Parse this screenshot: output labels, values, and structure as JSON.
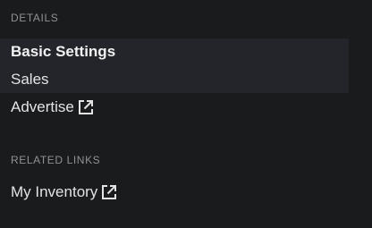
{
  "details": {
    "heading": "DETAILS",
    "items": [
      {
        "label": "Basic Settings"
      },
      {
        "label": "Sales"
      },
      {
        "label": "Advertise",
        "icon": "external-link-icon"
      }
    ]
  },
  "related": {
    "heading": "RELATED LINKS",
    "items": [
      {
        "label": "My Inventory",
        "icon": "external-link-icon"
      }
    ]
  },
  "colors": {
    "background": "#1a1b1d",
    "highlight": "#23252a",
    "heading": "#8f9194",
    "text": "#e3e3e3"
  }
}
